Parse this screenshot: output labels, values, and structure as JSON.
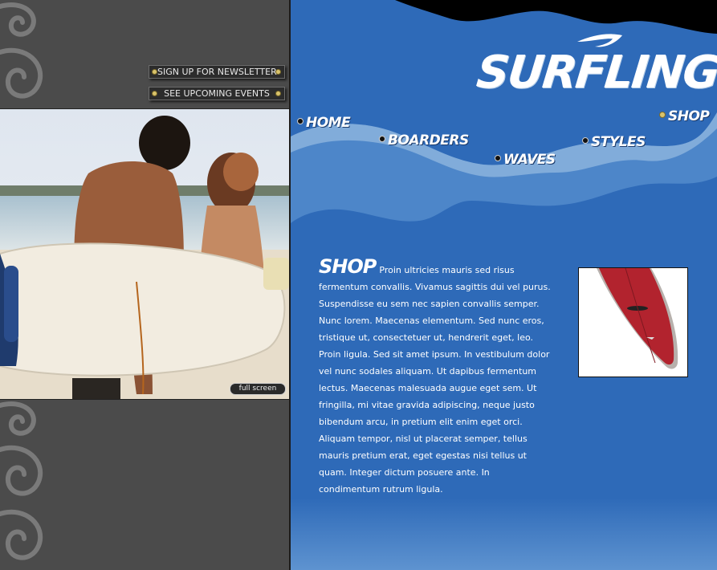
{
  "left": {
    "newsletter_label": "SIGN UP FOR NEWSLETTER",
    "events_label": "SEE UPCOMING EVENTS",
    "fullscreen_label": "full screen"
  },
  "header": {
    "logo_text": "SURFLING"
  },
  "nav": {
    "home": "HOME",
    "boarders": "BOARDERS",
    "waves": "WAVES",
    "styles": "STYLES",
    "shop": "SHOP"
  },
  "content": {
    "heading": "SHOP",
    "body": "Proin ultricies mauris sed risus fermentum convallis. Vivamus sagittis dui vel purus. Suspendisse eu sem nec sapien convallis semper. Nunc lorem. Maecenas elementum. Sed nunc eros, tristique ut, consectetuer ut, hendrerit eget, leo. Proin ligula. Sed sit amet ipsum. In vestibulum dolor vel nunc sodales aliquam. Ut dapibus fermentum lectus. Maecenas malesuada augue eget sem. Ut fringilla, mi vitae gravida adipiscing, neque justo bibendum arcu, in pretium elit enim eget orci. Aliquam tempor, nisl ut placerat semper, tellus mauris pretium erat, eget egestas nisi tellus ut quam. Integer dictum posuere ante. In condimentum rutrum ligula."
  },
  "colors": {
    "right_bg": "#2e6ab8",
    "left_bg": "#4b4b4b",
    "accent": "#d9c36b"
  }
}
